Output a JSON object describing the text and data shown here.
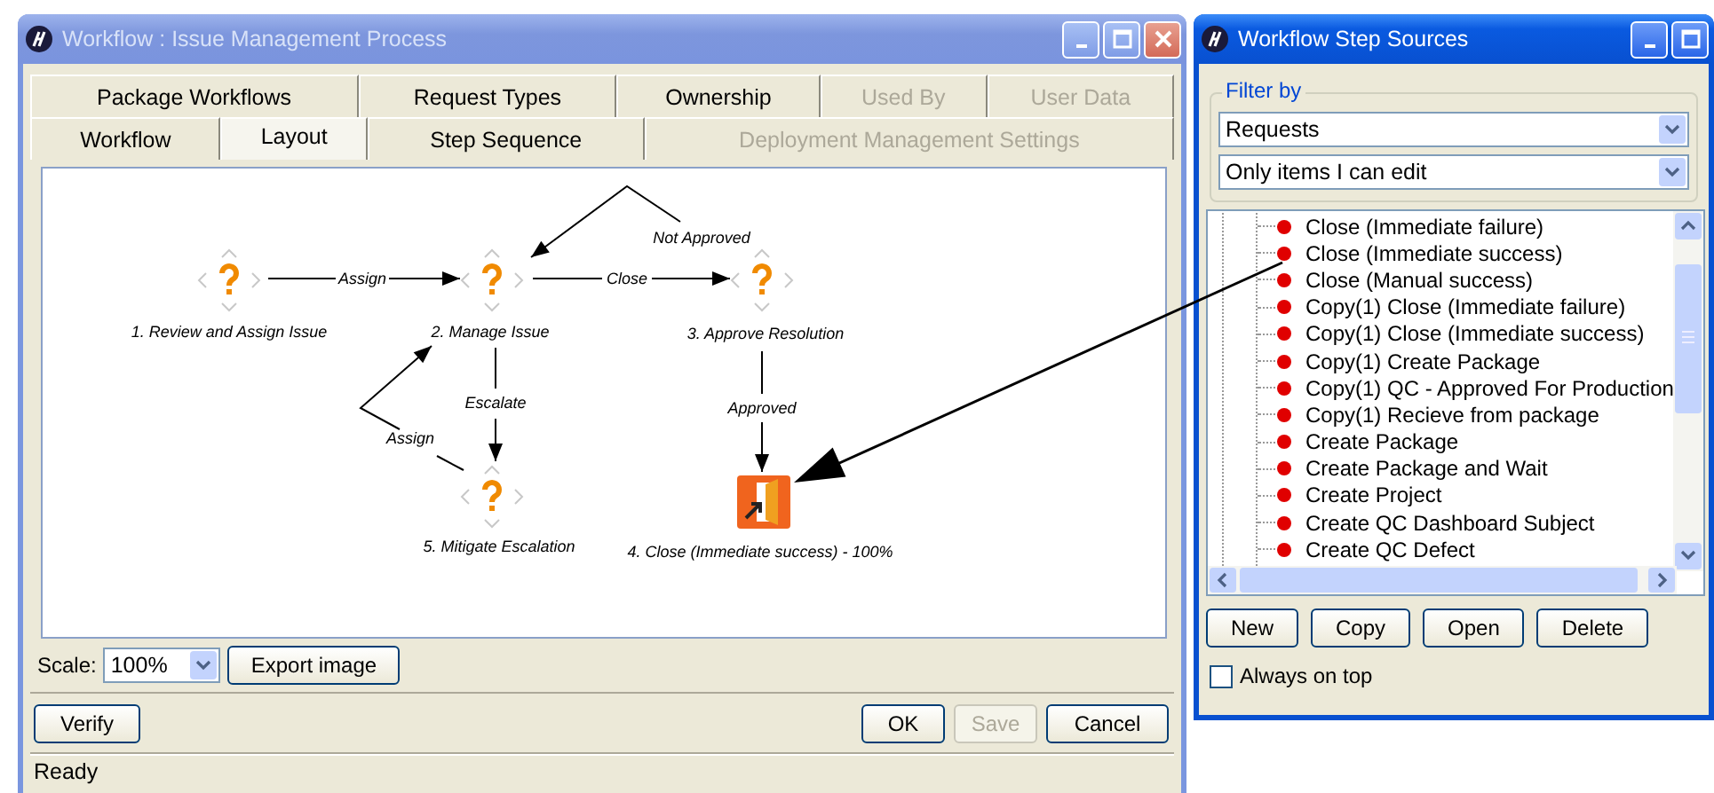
{
  "main_window": {
    "title": "Workflow : Issue Management Process"
  },
  "tab_rows": [
    [
      {
        "label": "Package Workflows",
        "selected": false,
        "disabled": false
      },
      {
        "label": "Request Types",
        "selected": false,
        "disabled": false
      },
      {
        "label": "Ownership",
        "selected": false,
        "disabled": false
      },
      {
        "label": "Used By",
        "selected": false,
        "disabled": true
      },
      {
        "label": "User Data",
        "selected": false,
        "disabled": true
      }
    ],
    [
      {
        "label": "Workflow",
        "selected": false,
        "disabled": false
      },
      {
        "label": "Layout",
        "selected": true,
        "disabled": false
      },
      {
        "label": "Step Sequence",
        "selected": false,
        "disabled": false
      },
      {
        "label": "Deployment Management Settings",
        "selected": false,
        "disabled": true
      }
    ]
  ],
  "diagram": {
    "nodes": [
      {
        "kind": "step",
        "label": "1. Review and Assign Issue"
      },
      {
        "kind": "step",
        "label": "2. Manage Issue"
      },
      {
        "kind": "step",
        "label": "3. Approve Resolution"
      },
      {
        "kind": "step",
        "label": "5. Mitigate Escalation"
      },
      {
        "kind": "close",
        "label": "4. Close (Immediate success) - 100%"
      }
    ],
    "edges": [
      {
        "label": "Assign"
      },
      {
        "label": "Close"
      },
      {
        "label": "Not Approved"
      },
      {
        "label": "Escalate"
      },
      {
        "label": "Assign"
      },
      {
        "label": "Approved"
      }
    ]
  },
  "scale": {
    "label": "Scale:",
    "value": "100%"
  },
  "export_button": "Export image",
  "verify_button": "Verify",
  "dialog_buttons": [
    {
      "label": "OK",
      "disabled": false
    },
    {
      "label": "Save",
      "disabled": true
    },
    {
      "label": "Cancel",
      "disabled": false
    }
  ],
  "status_bar": "Ready",
  "sources_window": {
    "title": "Workflow Step Sources",
    "filter_label": "Filter by",
    "filter_type": "Requests",
    "filter_scope": "Only items I can edit",
    "items": [
      "Close (Immediate failure)",
      "Close (Immediate success)",
      "Close (Manual success)",
      "Copy(1) Close (Immediate failure)",
      "Copy(1) Close (Immediate success)",
      "Copy(1) Create Package",
      "Copy(1) QC - Approved For Production",
      "Copy(1) Recieve from package",
      "Create Package",
      "Create Package and Wait",
      "Create Project",
      "Create QC Dashboard Subject",
      "Create QC Defect"
    ],
    "buttons": [
      "New",
      "Copy",
      "Open",
      "Delete"
    ],
    "always_on_top": {
      "label": "Always on top",
      "checked": false
    }
  }
}
